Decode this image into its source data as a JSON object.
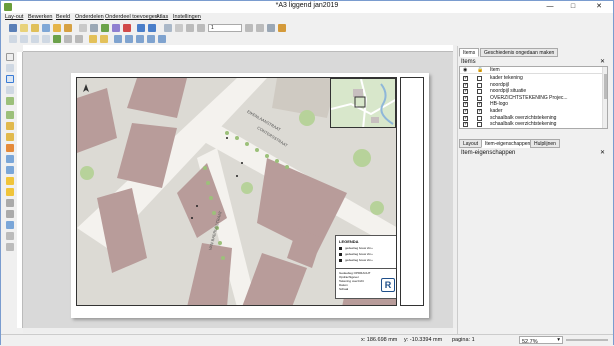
{
  "window": {
    "title": "*A3 liggend jan2019",
    "minimize": "—",
    "maximize": "□",
    "close": "✕"
  },
  "menu": [
    "Lay-out",
    "Bewerken",
    "Beeld",
    "Onderdelen",
    "Onderdeel toevoegen",
    "Atlas",
    "Instellingen"
  ],
  "toolbar": {
    "page_value": "1"
  },
  "map": {
    "streets": [
      "EIKENLAANSTRAAT",
      "CONTERSSTRAAT",
      "VAN BAERLESTRAAT"
    ]
  },
  "legend": {
    "title": "LEGENDA",
    "entries": [
      "gedeelteg bouw 2m+",
      "gedeelteg bouw 2m+",
      "gedeelteg bouw 2m+"
    ]
  },
  "titleblock": {
    "lines": [
      "Gedeelteg OPDRACHT",
      "Opdrachtgever",
      "Tekening overzicht",
      "Datum",
      "Schaal"
    ],
    "logo": "R"
  },
  "panel": {
    "tabs": [
      "Items",
      "Geschiedenis ongedaan maken"
    ],
    "items_header": "Items",
    "items_col": "Item",
    "items": [
      {
        "label": "kader tekening",
        "visible": true,
        "locked": false
      },
      {
        "label": "noordpijl",
        "visible": true,
        "locked": false
      },
      {
        "label": "noordpijl situatie",
        "visible": true,
        "locked": false
      },
      {
        "label": "OVERZICHTSTEKENING Projec...",
        "visible": true,
        "locked": false
      },
      {
        "label": "HB-logo",
        "visible": true,
        "locked": true
      },
      {
        "label": "kader",
        "visible": true,
        "locked": true
      },
      {
        "label": "schaalbalk overzichtstekening",
        "visible": true,
        "locked": false
      },
      {
        "label": "schaalbalk overzichtstekening",
        "visible": true,
        "locked": false
      }
    ],
    "bottom_tabs": [
      "Layout",
      "Item-eigenschappen",
      "Hulplijnen"
    ],
    "props_header": "Item-eigenschappen"
  },
  "status": {
    "x": "x: 186.698 mm",
    "y": "y: -10.3394 mm",
    "page": "pagina: 1",
    "zoom": "52.7%"
  },
  "colors": {
    "accent": "#3a7bd5",
    "map_bg": "#dcdad4",
    "building": "#b89c9a",
    "road": "#f4f2ee",
    "green": "#b7d29a"
  }
}
